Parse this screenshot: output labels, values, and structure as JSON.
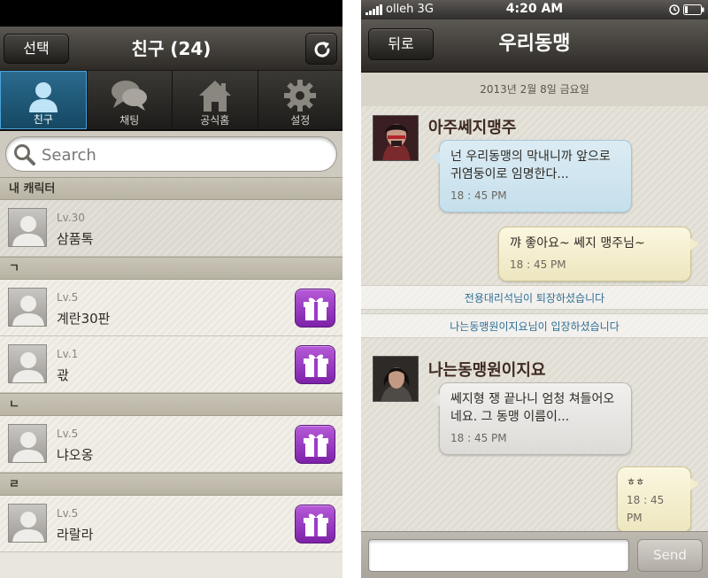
{
  "left": {
    "nav": {
      "select_label": "선택",
      "title": "친구 (24)"
    },
    "tabs": [
      {
        "label": "친구",
        "icon": "person-icon"
      },
      {
        "label": "채팅",
        "icon": "chat-bubbles-icon"
      },
      {
        "label": "공식홈",
        "icon": "home-icon"
      },
      {
        "label": "설정",
        "icon": "gear-icon"
      }
    ],
    "search": {
      "placeholder": "Search"
    },
    "sections": {
      "me": "내 캐릭터",
      "g": "ㄱ",
      "n": "ㄴ",
      "r": "ㄹ"
    },
    "friends": {
      "me": {
        "level": "Lv.30",
        "name": "삼품톡"
      },
      "f1": {
        "level": "Lv.5",
        "name": "계란30판"
      },
      "f2": {
        "level": "Lv.1",
        "name": "곿"
      },
      "f3": {
        "level": "Lv.5",
        "name": "냐오옹"
      },
      "f4": {
        "level": "Lv.5",
        "name": "라랄라"
      }
    }
  },
  "right": {
    "status": {
      "carrier": "olleh 3G",
      "time": "4:20 AM"
    },
    "nav": {
      "back_label": "뒤로",
      "title": "우리동맹"
    },
    "date": "2013년 2월 8일 금요일",
    "messages": {
      "m1": {
        "sender": "아주쎄지맹주",
        "text": "넌 우리동맹의 막내니까 앞으로 귀염둥이로 임명한다...",
        "time": "18 : 45 PM"
      },
      "m2": {
        "text": "꺄 좋아요~ 쎄지 맹주님~",
        "time": "18 : 45 PM"
      },
      "sys1": "전용대리석님이 퇴장하셨습니다",
      "sys2": "나는동맹원이지요님이 입장하셨습니다",
      "m3": {
        "sender": "나는동맹원이지요",
        "text": "쎄지형 쟁 끝나니 엄청 쳐들어오네요. 그 동맹 이름이...",
        "time": "18 : 45 PM"
      },
      "m4": {
        "text": "ㅎㅎ",
        "time": "18 : 45 PM"
      }
    },
    "input": {
      "value": "",
      "send_label": "Send"
    }
  }
}
